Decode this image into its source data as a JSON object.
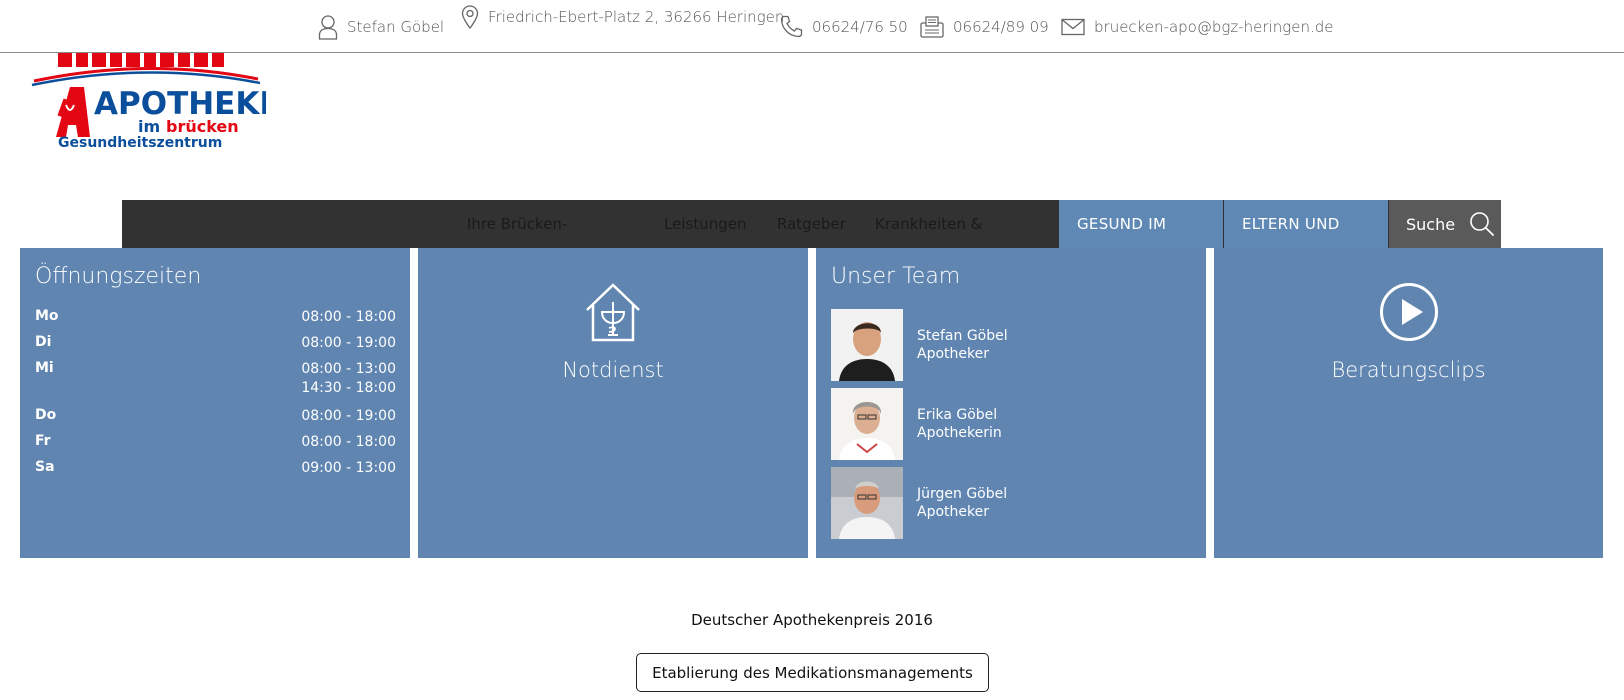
{
  "contact": {
    "owner": "Stefan Göbel",
    "address": "Friedrich-Ebert-Platz 2, 36266 Heringen",
    "phone": "06624/76 50",
    "fax": "06624/89 09",
    "email": "bruecken-apo@bgz-heringen.de"
  },
  "logo": {
    "line1": "APOTHEKE",
    "line2a": "im",
    "line2b": "brücken",
    "line3": "Gesundheitszentrum"
  },
  "nav": {
    "items": [
      "Ihre Brücken-",
      "Leistungen",
      "Ratgeber",
      "Krankheiten &"
    ],
    "highlight": [
      "GESUND IM",
      "ELTERN UND"
    ],
    "search_label": "Suche"
  },
  "hours": {
    "title": "Öffnungszeiten",
    "rows": [
      {
        "day": "Mo",
        "times": [
          "08:00 - 18:00"
        ]
      },
      {
        "day": "Di",
        "times": [
          "08:00 - 19:00"
        ]
      },
      {
        "day": "Mi",
        "times": [
          "08:00 - 13:00",
          "14:30 - 18:00"
        ]
      },
      {
        "day": "Do",
        "times": [
          "08:00 - 19:00"
        ]
      },
      {
        "day": "Fr",
        "times": [
          "08:00 - 18:00"
        ]
      },
      {
        "day": "Sa",
        "times": [
          "09:00 - 13:00"
        ]
      }
    ]
  },
  "notdienst": {
    "label": "Notdienst",
    "icon": "pharmacy-house-icon"
  },
  "team": {
    "title": "Unser Team",
    "members": [
      {
        "name": "Stefan Göbel",
        "role": "Apotheker"
      },
      {
        "name": "Erika Göbel",
        "role": "Apothekerin"
      },
      {
        "name": "Jürgen Göbel",
        "role": "Apotheker"
      }
    ]
  },
  "clips": {
    "label": "Beratungsclips",
    "icon": "play-circle-icon"
  },
  "award": {
    "text": "Deutscher Apothekenpreis 2016",
    "button_label": "Etablierung des Medikationsmanagements"
  },
  "colors": {
    "panel_blue": "#5f85b0",
    "nav_dark": "#333233",
    "logo_red": "#e30613",
    "logo_blue": "#0b4f9c"
  }
}
